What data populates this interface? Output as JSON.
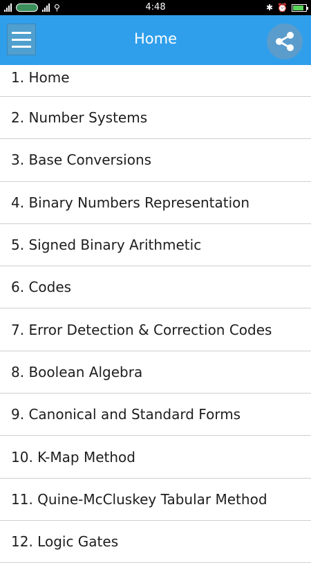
{
  "status_bar": {
    "time": "4:48",
    "battery_level": 0.85
  },
  "app_bar": {
    "title": "Home",
    "menu_icon": "hamburger-menu-icon",
    "share_icon": "share-icon",
    "color": "#2f9fec"
  },
  "menu": {
    "items": [
      {
        "label": "1. Home"
      },
      {
        "label": "2. Number Systems"
      },
      {
        "label": "3. Base Conversions"
      },
      {
        "label": "4. Binary Numbers Representation"
      },
      {
        "label": "5. Signed Binary Arithmetic"
      },
      {
        "label": "6. Codes"
      },
      {
        "label": "7. Error Detection & Correction Codes"
      },
      {
        "label": "8. Boolean Algebra"
      },
      {
        "label": "9. Canonical and Standard Forms"
      },
      {
        "label": "10. K-Map Method"
      },
      {
        "label": "11. Quine-McCluskey Tabular Method"
      },
      {
        "label": "12. Logic Gates"
      }
    ]
  }
}
